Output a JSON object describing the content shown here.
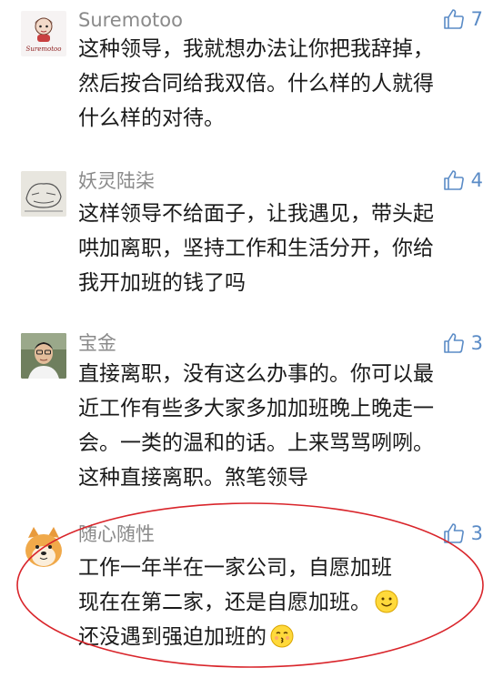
{
  "comments": [
    {
      "username": "Suremotoo",
      "avatar_text": "Suremotoo",
      "likes": "7",
      "lines": [
        "这种领导，我就想办法让你把我辞掉，",
        "然后按合同给我双倍。什么样的人就得",
        "什么样的对待。"
      ]
    },
    {
      "username": "妖灵陆柒",
      "likes": "4",
      "lines": [
        "这样领导不给面子，让我遇见，带头起",
        "哄加离职，坚持工作和生活分开，你给",
        "我开加班的钱了吗"
      ]
    },
    {
      "username": "宝金",
      "likes": "3",
      "lines": [
        "直接离职，没有这么办事的。你可以最",
        "近工作有些多大家多加加班晚上晚走一",
        "会。一类的温和的话。上来骂骂咧咧。",
        "这种直接离职。煞笔领导"
      ]
    },
    {
      "username": "随心随性",
      "likes": "3",
      "lines": [
        "工作一年半在一家公司，自愿加班",
        "现在在第二家，还是自愿加班。",
        "还没遇到强迫加班的"
      ],
      "emojis": [
        "smiling-face",
        "kissing-face"
      ]
    }
  ],
  "colors": {
    "username": "#8a8a8a",
    "like_accent": "#5a8bc6",
    "body_text": "#1a1a1a",
    "highlight_circle": "#d9252b"
  }
}
